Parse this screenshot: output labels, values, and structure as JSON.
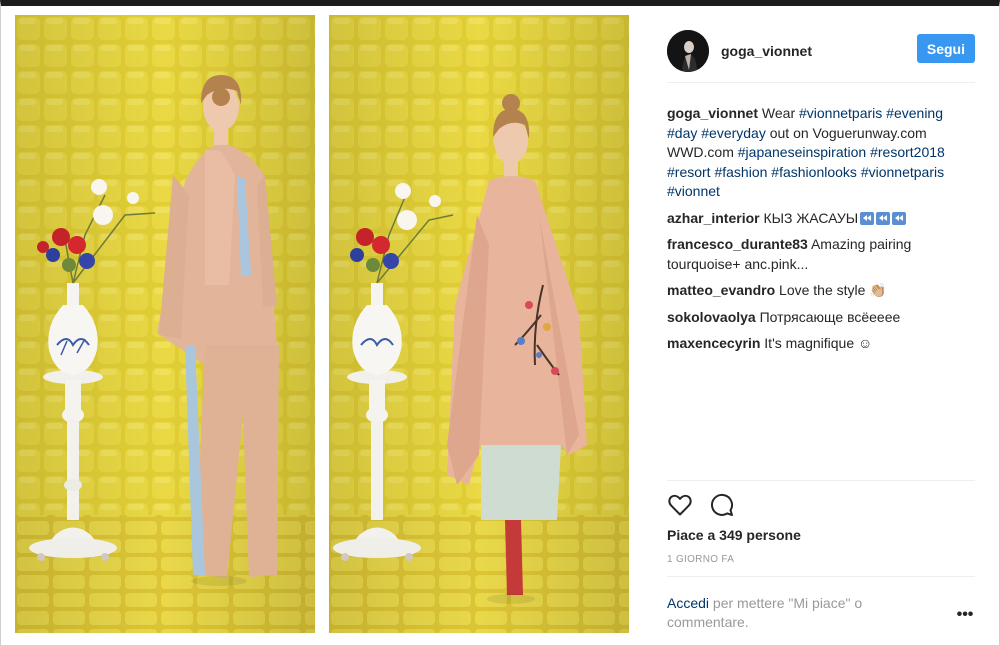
{
  "post": {
    "username": "goga_vionnet",
    "follow_label": "Segui",
    "caption": {
      "user": "goga_vionnet",
      "text_1": " Wear ",
      "tag_1": "#vionnetparis",
      "text_2": " ",
      "tag_2": "#evening",
      "text_3": " ",
      "tag_3": "#day",
      "text_4": " ",
      "tag_4": "#everyday",
      "text_5": " out on Voguerunway.com WWD.com ",
      "tag_5": "#japaneseinspiration",
      "text_6": " ",
      "tag_6": "#resort2018",
      "text_7": " ",
      "tag_7": "#resort",
      "text_8": " ",
      "tag_8": "#fashion",
      "text_9": " ",
      "tag_9": "#fashionlooks",
      "text_10": " ",
      "tag_10": "#vionnetparis",
      "text_11": " ",
      "tag_11": "#vionnet"
    },
    "comments": [
      {
        "user": "azhar_interior",
        "text": " КЫЗ ЖАСАУЫ",
        "emoji": "rewind-emoji-icon"
      },
      {
        "user": "francesco_durante83",
        "text": " Amazing pairing tourquoise+ anc.pink..."
      },
      {
        "user": "matteo_evandro",
        "text": " Love the style 👏🏼"
      },
      {
        "user": "sokolovaolya",
        "text": " Потрясающе всёееее"
      },
      {
        "user": "maxencecyrin",
        "text": " It's magnifique ☺"
      }
    ],
    "likes": "Piace a 349 persone",
    "time": "1 GIORNO FA",
    "login_link": "Accedi",
    "login_text": " per mettere \"Mi piace\" o commentare.",
    "more_label": "•••"
  },
  "colors": {
    "accent": "#3897f0",
    "link": "#003569",
    "muted": "#999999",
    "backdrop_yellow": "#e6d23a"
  },
  "icons": {
    "like": "heart-icon",
    "comment": "comment-bubble-icon",
    "more": "more-options-icon"
  }
}
